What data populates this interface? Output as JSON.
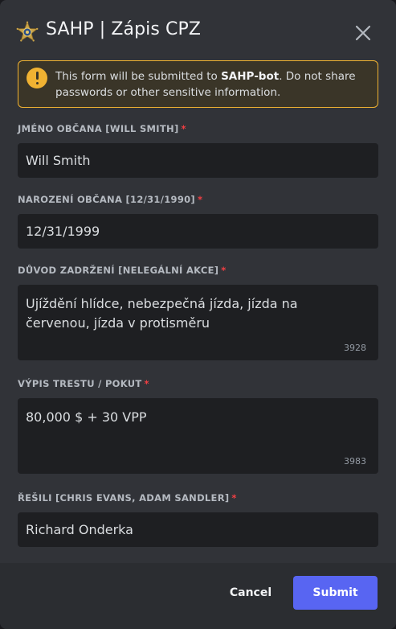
{
  "dialog": {
    "title": "SAHP | Zápis CPZ",
    "logo_icon": "sheriff-star-badge-icon",
    "close_icon": "close-icon"
  },
  "notice": {
    "icon": "warning-icon",
    "text_before": "This form will be submitted to ",
    "bot_name": "SAHP-bot",
    "text_after": ". Do not share passwords or other sensitive information.",
    "border_color": "#f0b232"
  },
  "fields": [
    {
      "label": "JMÉNO OBČANA [WILL SMITH]",
      "required_mark": "*",
      "value": "Will Smith"
    },
    {
      "label": "NAROZENÍ OBČANA [12/31/1990]",
      "required_mark": "*",
      "value": "12/31/1999"
    },
    {
      "label": "DŮVOD ZADRŽENÍ [NELEGÁLNÍ AKCE]",
      "required_mark": "*",
      "value": "Ujíždění hlídce, nebezpečná jízda, jízda na červenou, jízda v protisměru",
      "remaining_chars": "3928"
    },
    {
      "label": "VÝPIS TRESTU / POKUT",
      "required_mark": "*",
      "value": "80,000 $ + 30 VPP",
      "remaining_chars": "3983"
    },
    {
      "label": "ŘEŠILI [CHRIS EVANS, ADAM SANDLER]",
      "required_mark": "*",
      "value": "Richard Onderka"
    }
  ],
  "footer": {
    "cancel_label": "Cancel",
    "submit_label": "Submit",
    "submit_color": "#5865f2"
  }
}
